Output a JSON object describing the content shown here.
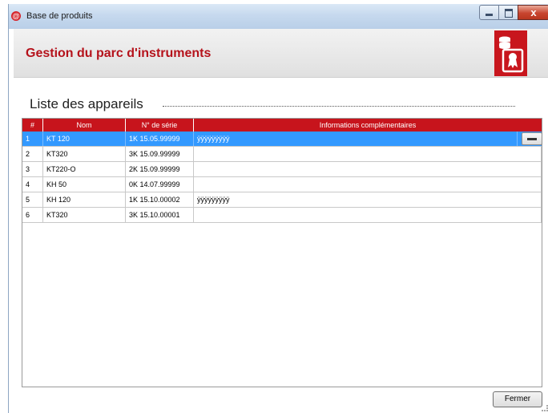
{
  "window": {
    "title": "Base de produits",
    "app_icon": "app-logo-icon",
    "controls": [
      "minimize-icon",
      "maximize-icon",
      "close-icon"
    ]
  },
  "header": {
    "title": "Gestion du parc d'instruments",
    "logo": "database-certificate-icon",
    "accent": "#c8161d"
  },
  "section": {
    "title": "Liste des appareils"
  },
  "grid": {
    "columns": [
      "#",
      "Nom",
      "N° de série",
      "Informations complémentaires"
    ],
    "header_color": "#c7141c",
    "selected_color": "#3399ff",
    "rows": [
      {
        "index": "1",
        "name": "KT 120",
        "serial": "1K 15.05.99999",
        "info": "ÿÿÿÿÿÿÿÿÿ"
      },
      {
        "index": "2",
        "name": "KT320",
        "serial": "3K 15.09.99999",
        "info": ""
      },
      {
        "index": "3",
        "name": "KT220-O",
        "serial": "2K 15.09.99999",
        "info": ""
      },
      {
        "index": "4",
        "name": "KH 50",
        "serial": "0K 14.07.99999",
        "info": ""
      },
      {
        "index": "5",
        "name": "KH 120",
        "serial": "1K 15.10.00002",
        "info": "ÿÿÿÿÿÿÿÿÿ"
      },
      {
        "index": "6",
        "name": "KT320",
        "serial": "3K 15.10.00001",
        "info": ""
      }
    ],
    "selected_row": 1,
    "row_action_icon": "minus-icon"
  },
  "footer": {
    "close_label": "Fermer"
  }
}
